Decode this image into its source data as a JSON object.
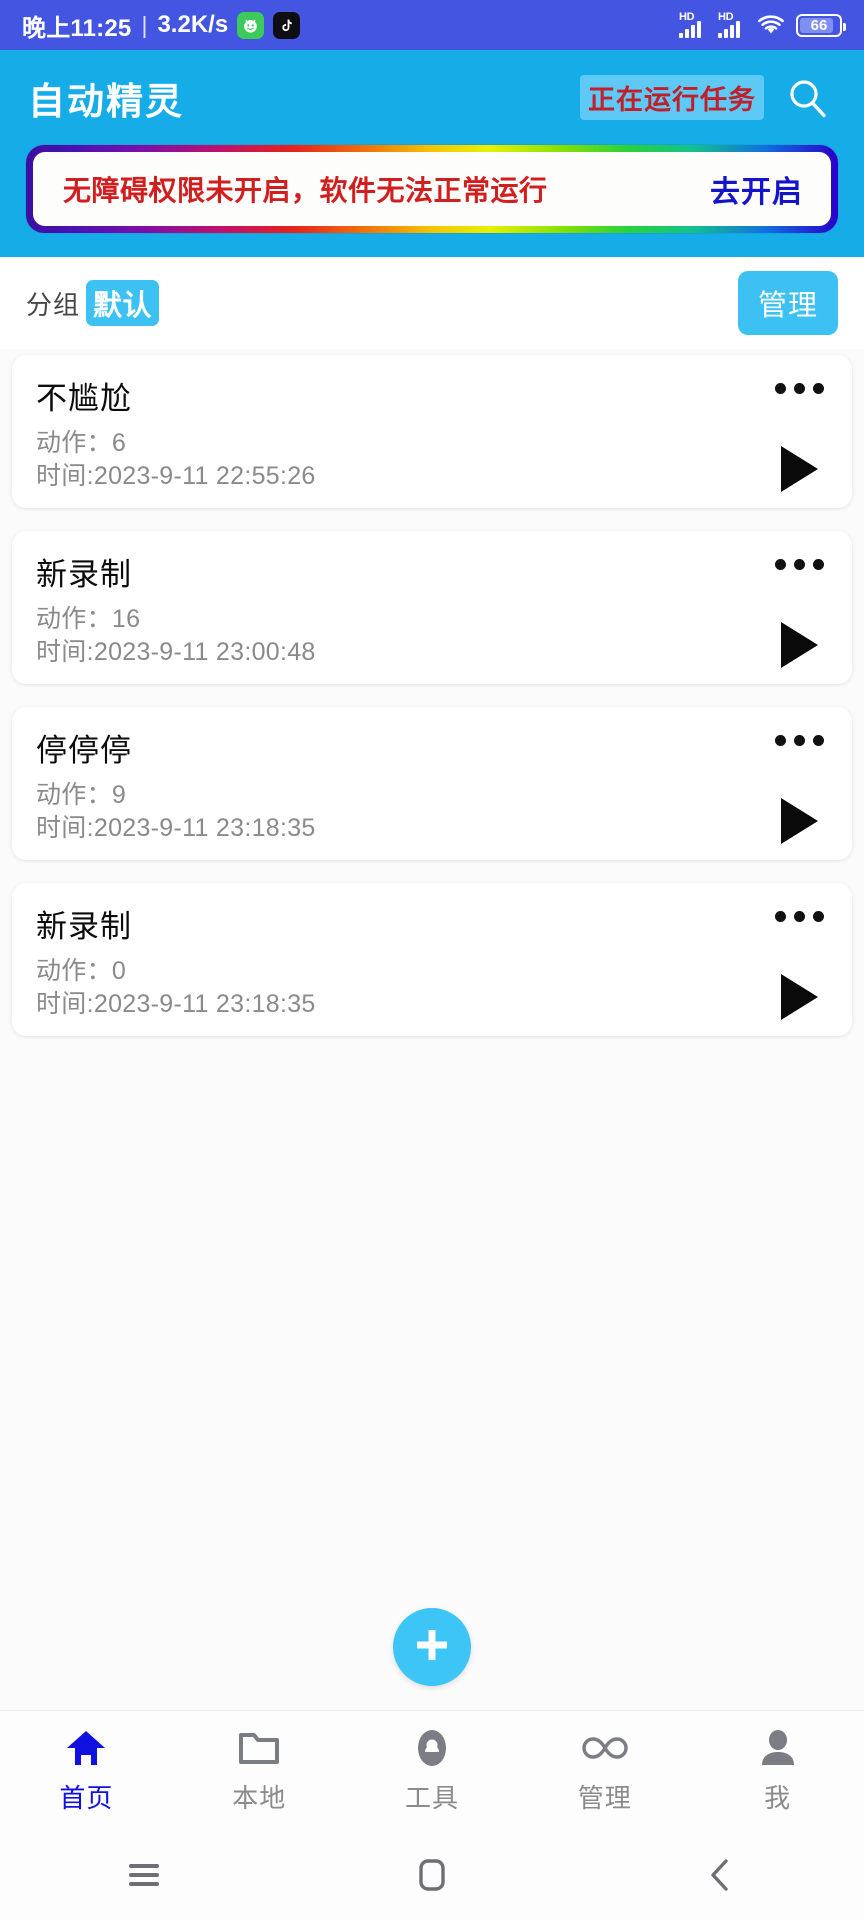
{
  "status_bar": {
    "time": "晚上11:25",
    "separator": "|",
    "network_speed": "3.2K/s",
    "app_icon_1": "green-face-icon",
    "app_icon_2": "tiktok-icon",
    "signal_1_label": "HD",
    "signal_2_label": "HD",
    "wifi_icon": "wifi-icon",
    "battery_level": "66",
    "bg_color": "#4455e2"
  },
  "header": {
    "app_title": "自动精灵",
    "running_badge": "正在运行任务",
    "search_icon": "search-icon",
    "bg_color": "#16ace8",
    "badge_bg": "#5ec9f4",
    "badge_text_color": "#c0202a"
  },
  "warning_banner": {
    "message": "无障碍权限未开启，软件无法正常运行",
    "action_label": "去开启",
    "message_color": "#d11f1f",
    "action_color": "#1414c8"
  },
  "group_bar": {
    "label": "分组",
    "selected_group": "默认",
    "manage_label": "管理",
    "accent_color": "#3dc1f2"
  },
  "tasks": [
    {
      "title": "不尴尬",
      "actions_label": "动作：",
      "actions_value": "6",
      "time_label": "时间:",
      "time_value": "2023-9-11 22:55:26",
      "menu_icon": "more-options-icon",
      "play_icon": "play-icon"
    },
    {
      "title": "新录制",
      "actions_label": "动作：",
      "actions_value": "16",
      "time_label": "时间:",
      "time_value": "2023-9-11 23:00:48",
      "menu_icon": "more-options-icon",
      "play_icon": "play-icon"
    },
    {
      "title": "停停停",
      "actions_label": "动作：",
      "actions_value": "9",
      "time_label": "时间:",
      "time_value": "2023-9-11 23:18:35",
      "menu_icon": "more-options-icon",
      "play_icon": "play-icon"
    },
    {
      "title": "新录制",
      "actions_label": "动作：",
      "actions_value": "0",
      "time_label": "时间:",
      "time_value": "2023-9-11 23:18:35",
      "menu_icon": "more-options-icon",
      "play_icon": "play-icon"
    }
  ],
  "fab": {
    "icon": "plus-icon",
    "color": "#3dc5f5"
  },
  "tab_bar": {
    "active_color": "#1010e0",
    "inactive_color": "#8b8b8b",
    "items": [
      {
        "label": "首页",
        "icon": "home-icon",
        "active": true
      },
      {
        "label": "本地",
        "icon": "folder-icon",
        "active": false
      },
      {
        "label": "工具",
        "icon": "cloud-icon",
        "active": false
      },
      {
        "label": "管理",
        "icon": "infinity-icon",
        "active": false
      },
      {
        "label": "我",
        "icon": "person-icon",
        "active": false
      }
    ]
  },
  "android_nav": {
    "recents_icon": "menu-icon",
    "home_icon": "home-square-icon",
    "back_icon": "back-chevron-icon"
  }
}
